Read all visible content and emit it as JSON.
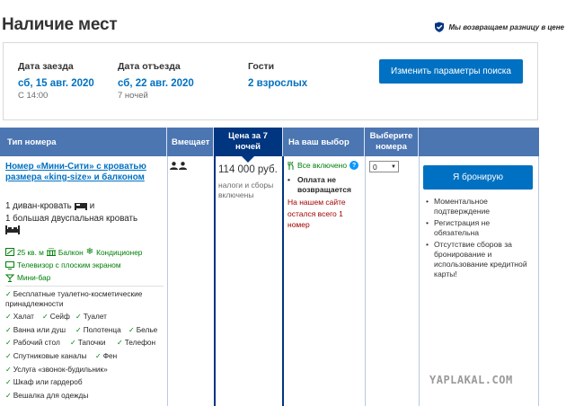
{
  "header": {
    "title": "Наличие мест",
    "guarantee": "Мы возвращаем разницу в цене"
  },
  "search": {
    "checkin_label": "Дата заезда",
    "checkin_value": "сб, 15 авг. 2020",
    "checkin_time": "С 14:00",
    "checkout_label": "Дата отъезда",
    "checkout_value": "сб, 22 авг. 2020",
    "nights": "7 ночей",
    "guests_label": "Гости",
    "guests_value": "2 взрослых",
    "change_button": "Изменить параметры поиска"
  },
  "table": {
    "headers": {
      "room_type": "Тип номера",
      "sleeps": "Вмещает",
      "price_line1": "Цена за 7",
      "price_line2": "ночей",
      "choice": "На ваш выбор",
      "select_line1": "Выберите",
      "select_line2": "номера"
    }
  },
  "room": {
    "name": "Номер «Мини-Сити» с кроватью размера «king-size» и балконом",
    "bed1": "1 диван-кровать",
    "bed_and": "и",
    "bed2": "1 большая двуспальная кровать",
    "size": "25 кв. м",
    "balcony": "Балкон",
    "aircon": "Кондиционер",
    "tv": "Телевизор с плоским экраном",
    "minibar": "Мини-бар",
    "facilities": [
      "Бесплатные туалетно-косметические",
      "принадлежности",
      "Халат",
      "Сейф",
      "Туалет",
      "Ванна или душ",
      "Полотенца",
      "Белье",
      "Рабочий стол",
      "Тапочки",
      "Телефон",
      "Спутниковые каналы",
      "Фен",
      "Услуга «звонок-будильник»",
      "Шкаф или гардероб",
      "Вешалка для одежды"
    ],
    "price": "114 000 руб.",
    "taxes": "налоги и сборы включены",
    "included": "Все включено",
    "no_prepayment": "Оплата не возвращается",
    "scarcity": "На нашем сайте остался всего 1 номер",
    "select_value": "0",
    "book_button": "Я бронирую",
    "benefits": [
      "Моментальное подтверждение",
      "Регистрация не обязательна",
      "Отсутствие сборов за бронирование и использование кредитной карты!"
    ]
  },
  "watermark": "YAPLAKAL.COM",
  "colors": {
    "brand_blue": "#0071c2",
    "header_blue": "#4c76b2",
    "dark_blue": "#003580",
    "green": "#008009",
    "red": "#a30000"
  }
}
